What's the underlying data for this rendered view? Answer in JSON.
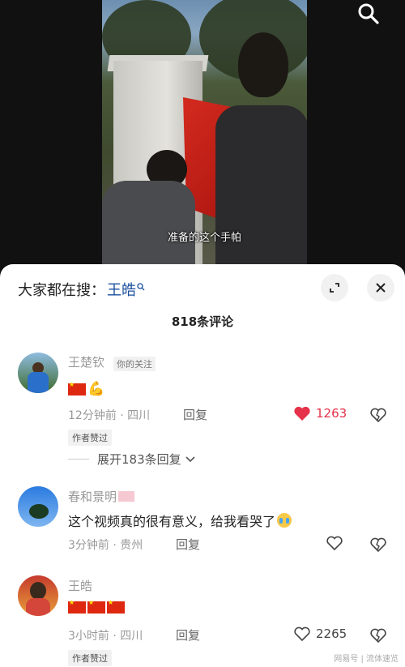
{
  "video": {
    "subtitle": "准备的这个手帕"
  },
  "icons": {
    "search": "search-icon",
    "expand": "expand-icon",
    "close": "close-icon"
  },
  "panel": {
    "search_prefix": "大家都在搜：",
    "search_term": "王皓",
    "comment_count_title": "818条评论"
  },
  "colors": {
    "like_active": "#e5324a",
    "search_term": "#1a4f9e",
    "flag_red": "#de2910"
  },
  "comments": [
    {
      "username": "王楚钦",
      "tag": "你的关注",
      "content_icons": [
        "china-flag",
        "flexed-biceps-emoji"
      ],
      "content_text": "",
      "time": "12分钟前 · 四川",
      "reply_label": "回复",
      "likes": "1263",
      "liked": true,
      "author_tag": "作者赞过",
      "expand_label": "展开183条回复"
    },
    {
      "username": "春和景明",
      "content_text": "这个视频真的很有意义，给我看哭了",
      "content_icons": [
        "crying-emoji"
      ],
      "time": "3分钟前 · 贵州",
      "reply_label": "回复",
      "likes": "",
      "liked": false
    },
    {
      "username": "王皓",
      "content_icons": [
        "china-flag",
        "china-flag",
        "china-flag"
      ],
      "content_text": "",
      "time": "3小时前 · 四川",
      "reply_label": "回复",
      "likes": "2265",
      "liked": false,
      "author_tag": "作者赞过"
    }
  ],
  "watermark": "网易号 | 流体速览"
}
